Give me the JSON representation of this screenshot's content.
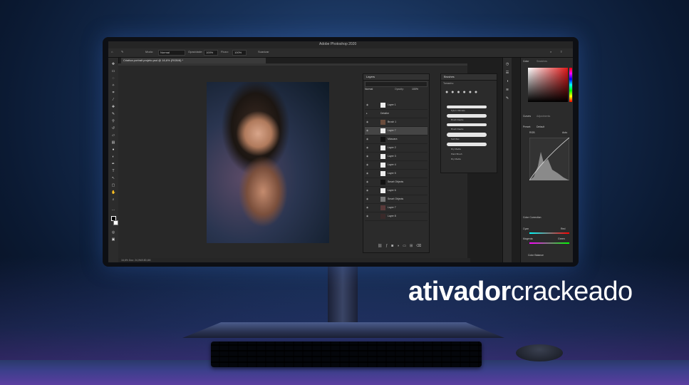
{
  "app": {
    "title": "Adobe Photoshop 2020",
    "document_tab": "Criativa portrait projeto.psd @ 16,6% (RGB/8) *",
    "options_bar": {
      "mode_label": "Modo:",
      "mode_value": "Normal",
      "opacity_label": "Opacidade:",
      "opacity_value": "100%",
      "flow_label": "Fluxo:",
      "flow_value": "100%",
      "smoothing_label": "Suavizar"
    },
    "status_bar": "16,6%   Doc: 24,0M/180,4M"
  },
  "layers_panel": {
    "title": "Layers",
    "blend_mode": "Normal",
    "opacity_label": "Opacity:",
    "opacity_value": "100%",
    "layers": [
      {
        "name": "Layer 1"
      },
      {
        "name": "Detalhe"
      },
      {
        "name": "Brush 1"
      },
      {
        "name": "Layer 7"
      },
      {
        "name": "Máscara"
      },
      {
        "name": "Layer 2"
      },
      {
        "name": "Layer 3"
      },
      {
        "name": "Layer 4"
      },
      {
        "name": "Layer 5"
      },
      {
        "name": "Smart Objects"
      },
      {
        "name": "Layer 6"
      },
      {
        "name": "Smart Objects"
      },
      {
        "name": "Layer 7"
      },
      {
        "name": "Layer 8"
      }
    ]
  },
  "brushes_panel": {
    "title": "Brushes",
    "size_label": "Tamanho",
    "brushes": [
      {
        "name": "Kyle's Ultimate"
      },
      {
        "name": "Brush Daubs"
      },
      {
        "name": "Brush Daubs"
      },
      {
        "name": "Soft Wet"
      },
      {
        "name": "Dry Media"
      },
      {
        "name": "Paint Brush"
      },
      {
        "name": "Dry Media"
      }
    ]
  },
  "right_panels": {
    "color_title": "Color",
    "swatches_title": "Swatches",
    "curves_title": "Curves",
    "adjustments_title": "Adjustments",
    "preset_label": "Preset:",
    "preset_value": "Default",
    "channel_value": "RGB",
    "auto_label": "Auto",
    "color_correction_title": "Color Correction",
    "cyan_label": "Cyan",
    "red_label": "Red",
    "magenta_label": "Magenta",
    "green_label": "Green",
    "color_balance_label": "Color Balance"
  },
  "brand": {
    "bold": "ativador",
    "light": "crackeado"
  },
  "colors": {
    "background": "#173056",
    "ui_dark": "#1e1e1e",
    "panel": "#2b2b2b",
    "accent_red": "#e01818"
  }
}
